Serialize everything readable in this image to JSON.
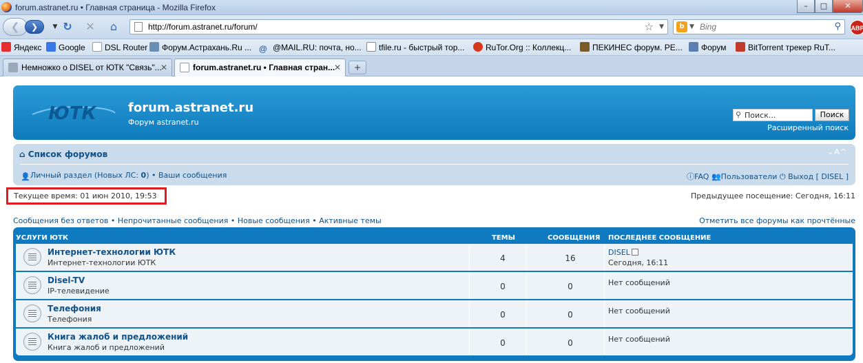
{
  "window": {
    "title": "forum.astranet.ru • Главная страница - Mozilla Firefox",
    "controls": {
      "minimize": "–",
      "maximize": "□",
      "close": "✕"
    }
  },
  "toolbar": {
    "url": "http://forum.astranet.ru/forum/",
    "search_placeholder": "Bing",
    "abp_label": "ABP"
  },
  "bookmarks": [
    {
      "label": "Яндекс",
      "color": "#e62e2e"
    },
    {
      "label": "Google",
      "color": "#3b78e7"
    },
    {
      "label": "DSL Router",
      "color": "#ffffff"
    },
    {
      "label": "Форум.Астрахань.Ru ...",
      "color": "#6b8fb3"
    },
    {
      "label": "@MAIL.RU: почта, но...",
      "color": "#1a5ba8"
    },
    {
      "label": "tfile.ru - быстрый тор...",
      "color": "#ffffff"
    },
    {
      "label": "RuTor.Org :: Коллекц...",
      "color": "#d63a1e"
    },
    {
      "label": "ПЕКИНЕС форум. РЕ...",
      "color": "#7a5a2a"
    },
    {
      "label": "Форум",
      "color": "#5b7fb0"
    },
    {
      "label": "BitTorrent трекер RuT...",
      "color": "#c43a2a"
    }
  ],
  "tabs": [
    {
      "label": "Немножко о DISEL от ЮТК \"Связь\"..."
    },
    {
      "label": "forum.astranet.ru • Главная стран..."
    }
  ],
  "header": {
    "site_title": "forum.astranet.ru",
    "site_desc": "Форум astranet.ru",
    "search_placeholder": "Поиск...",
    "search_button": "Поиск",
    "advanced_search": "Расширенный поиск",
    "logo_text": "ЮТК"
  },
  "nav": {
    "forum_list": "Список форумов",
    "font_controls": "⌄A^",
    "personal_prefix": "Личный раздел (Новых ЛС: ",
    "personal_count": "0",
    "personal_suffix": ")",
    "your_posts": "Ваши сообщения",
    "faq": "FAQ",
    "users": "Пользователи",
    "logout": "Выход [ DISEL ]"
  },
  "info": {
    "current_time": "Текущее время: 01 июн 2010, 19:53",
    "last_visit": "Предыдущее посещение: Сегодня, 16:11"
  },
  "quicklinks": {
    "unanswered": "Сообщения без ответов",
    "unread": "Непрочитанные сообщения",
    "new_posts": "Новые сообщения",
    "active": "Активные темы",
    "mark_read": "Отметить все форумы как прочтённые"
  },
  "forum_table": {
    "headers": {
      "category": "Услуги ЮТК",
      "topics": "Темы",
      "posts": "Сообщения",
      "last_post": "Последнее сообщение"
    },
    "rows": [
      {
        "name": "Интернет-технологии ЮТК",
        "desc": "Интернет-технологии ЮТК",
        "topics": "4",
        "posts": "16",
        "last_author": "DISEL",
        "last_time": "Сегодня, 16:11"
      },
      {
        "name": "Disel-TV",
        "desc": "IP-телевидение",
        "topics": "0",
        "posts": "0",
        "last_none": "Нет сообщений"
      },
      {
        "name": "Телефония",
        "desc": "Телефония",
        "topics": "0",
        "posts": "0",
        "last_none": "Нет сообщений"
      },
      {
        "name": "Книга жалоб и предложений",
        "desc": "Книга жалоб и предложений",
        "topics": "0",
        "posts": "0",
        "last_none": "Нет сообщений"
      }
    ]
  }
}
